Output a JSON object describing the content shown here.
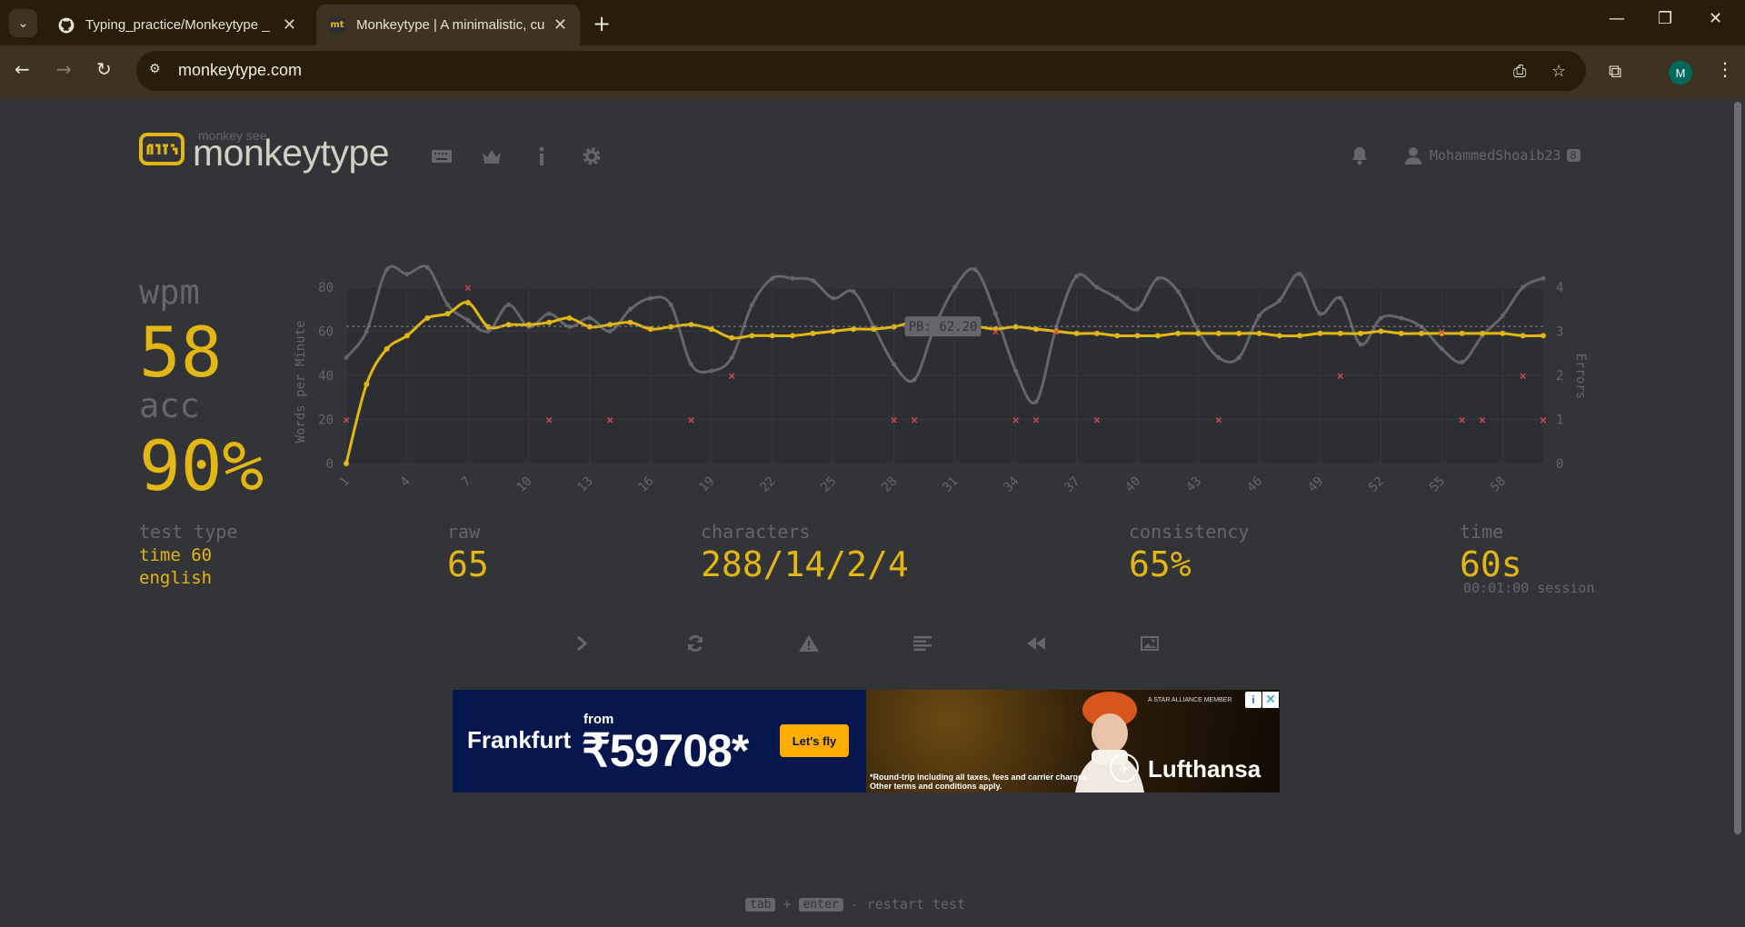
{
  "browser": {
    "tabs": [
      {
        "title": "Typing_practice/Monkeytype _",
        "icon": "github-icon",
        "active": false
      },
      {
        "title": "Monkeytype | A minimalistic, cu",
        "icon": "monkeytype-icon",
        "active": true
      }
    ],
    "url": "monkeytype.com",
    "profile_initial": "M"
  },
  "header": {
    "logo_sub": "monkey see",
    "logo_text": "monkeytype",
    "username": "MohammedShoaib23",
    "level": "8"
  },
  "results": {
    "wpm_label": "wpm",
    "wpm_value": "58",
    "acc_label": "acc",
    "acc_value": "90%",
    "test_type_label": "test type",
    "test_type_lines": [
      "time 60",
      "english"
    ],
    "raw_label": "raw",
    "raw_value": "65",
    "characters_label": "characters",
    "characters_value": "288/14/2/4",
    "consistency_label": "consistency",
    "consistency_value": "65%",
    "time_label": "time",
    "time_value": "60s",
    "session": "00:01:00 session"
  },
  "chart_data": {
    "type": "line",
    "ylabel": "Words per Minute",
    "y2label": "Errors",
    "x_ticks": [
      1,
      4,
      7,
      10,
      13,
      16,
      19,
      22,
      25,
      28,
      31,
      34,
      37,
      40,
      43,
      46,
      49,
      52,
      55,
      58
    ],
    "ylim": [
      0,
      80
    ],
    "y_ticks": [
      0,
      20,
      40,
      60,
      80
    ],
    "y2lim": [
      0,
      4
    ],
    "y2_ticks": [
      0,
      1,
      2,
      3,
      4
    ],
    "pb_label": "PB: 62.20",
    "pb_value": 62.2,
    "series": [
      {
        "name": "wpm",
        "color": "#e2b714",
        "x": [
          1,
          2,
          3,
          4,
          5,
          6,
          7,
          8,
          9,
          10,
          11,
          12,
          13,
          14,
          15,
          16,
          17,
          18,
          19,
          20,
          21,
          22,
          23,
          24,
          25,
          26,
          27,
          28,
          29,
          30,
          31,
          32,
          33,
          34,
          35,
          36,
          37,
          38,
          39,
          40,
          41,
          42,
          43,
          44,
          45,
          46,
          47,
          48,
          49,
          50,
          51,
          52,
          53,
          54,
          55,
          56,
          57,
          58,
          59,
          60
        ],
        "values": [
          0,
          36,
          52,
          58,
          66,
          68,
          73,
          62,
          63,
          63,
          64,
          66,
          62,
          63,
          64,
          61,
          62,
          63,
          61,
          57,
          58,
          58,
          58,
          59,
          60,
          61,
          61,
          62,
          64,
          61,
          60,
          62,
          61,
          62,
          61,
          60,
          59,
          59,
          58,
          58,
          58,
          59,
          59,
          59,
          59,
          59,
          58,
          58,
          59,
          59,
          59,
          60,
          59,
          59,
          59,
          59,
          59,
          59,
          58,
          58
        ]
      },
      {
        "name": "raw",
        "color": "#646669",
        "x": [
          1,
          2,
          3,
          4,
          5,
          6,
          7,
          8,
          9,
          10,
          11,
          12,
          13,
          14,
          15,
          16,
          17,
          18,
          19,
          20,
          21,
          22,
          23,
          24,
          25,
          26,
          27,
          28,
          29,
          30,
          31,
          32,
          33,
          34,
          35,
          36,
          37,
          38,
          39,
          40,
          41,
          42,
          43,
          44,
          45,
          46,
          47,
          48,
          49,
          50,
          51,
          52,
          53,
          54,
          55,
          56,
          57,
          58,
          59,
          60
        ],
        "values": [
          48,
          60,
          88,
          86,
          89,
          72,
          65,
          60,
          72,
          62,
          68,
          62,
          66,
          60,
          70,
          75,
          72,
          45,
          42,
          48,
          72,
          84,
          84,
          83,
          75,
          78,
          62,
          45,
          38,
          62,
          80,
          88,
          68,
          42,
          28,
          62,
          85,
          80,
          75,
          70,
          84,
          78,
          60,
          48,
          48,
          67,
          74,
          86,
          68,
          75,
          54,
          66,
          66,
          62,
          52,
          46,
          58,
          67,
          80,
          84
        ]
      },
      {
        "name": "errors",
        "color": "#ca4754",
        "x": [
          1,
          7,
          11,
          14,
          18,
          20,
          28,
          29,
          33,
          34,
          35,
          36,
          38,
          44,
          50,
          55,
          56,
          57,
          59,
          60
        ],
        "values": [
          1,
          4,
          1,
          1,
          1,
          2,
          1,
          1,
          3,
          1,
          1,
          3,
          1,
          1,
          2,
          3,
          1,
          1,
          2,
          1
        ]
      }
    ]
  },
  "actions": [
    {
      "name": "next-test-button",
      "icon": "chevron-right-icon"
    },
    {
      "name": "restart-test-button",
      "icon": "refresh-icon"
    },
    {
      "name": "practice-missed-button",
      "icon": "warning-icon"
    },
    {
      "name": "word-history-button",
      "icon": "text-align-icon"
    },
    {
      "name": "replay-button",
      "icon": "rewind-icon"
    },
    {
      "name": "screenshot-button",
      "icon": "image-icon"
    }
  ],
  "ad": {
    "city": "Frankfurt",
    "from": "from",
    "price": "₹59708*",
    "cta": "Let's fly",
    "fine_print": "*Round-trip including all taxes, fees and carrier charges. Other terms and conditions apply.",
    "brand": "Lufthansa",
    "tagline": "A STAR ALLIANCE MEMBER"
  },
  "footer": {
    "key1": "tab",
    "plus": "+",
    "key2": "enter",
    "hint": "- restart test"
  }
}
